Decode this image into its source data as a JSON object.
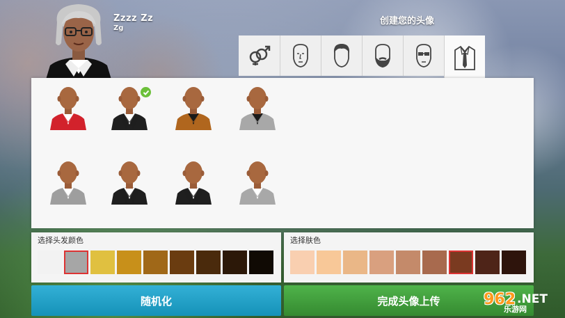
{
  "header": {
    "player_name": "Zzzz  Zz",
    "player_sub": "Zg",
    "title": "创建您的头像"
  },
  "tabs": [
    {
      "name": "gender",
      "icon": "gender-icon",
      "active": false
    },
    {
      "name": "face",
      "icon": "face-icon",
      "active": false
    },
    {
      "name": "hair",
      "icon": "hair-icon",
      "active": false
    },
    {
      "name": "beard",
      "icon": "beard-icon",
      "active": false
    },
    {
      "name": "glasses",
      "icon": "glasses-icon",
      "active": false
    },
    {
      "name": "outfit",
      "icon": "shirt-tie-icon",
      "active": true
    }
  ],
  "outfits": [
    {
      "jacket": "#d2222c",
      "shirt": "#ffffff",
      "selected": false
    },
    {
      "jacket": "#1f1f1f",
      "shirt": "#ffffff",
      "selected": true
    },
    {
      "jacket": "#b0661e",
      "shirt": "#1a1a1a",
      "selected": false
    },
    {
      "jacket": "#a8a8a8",
      "shirt": "#1a1a1a",
      "selected": false
    },
    {
      "jacket": "#9e9e9e",
      "shirt": "#ffffff",
      "selected": false
    },
    {
      "jacket": "#1f1f1f",
      "shirt": "#ffffff",
      "selected": false
    },
    {
      "jacket": "#1f1f1f",
      "shirt": "#ffffff",
      "selected": false
    },
    {
      "jacket": "#a8a8a8",
      "shirt": "#ffffff",
      "selected": false
    }
  ],
  "hair_color": {
    "label": "选择头发颜色",
    "swatches": [
      "#f2f2f2",
      "#a6a6a6",
      "#e0c040",
      "#c8901a",
      "#a06818",
      "#6a3c10",
      "#4a2a0c",
      "#2c1808",
      "#100a04"
    ],
    "selected_index": 1
  },
  "skin_color": {
    "label": "选择肤色",
    "swatches": [
      "#f9cfb0",
      "#f8c898",
      "#eab787",
      "#d9a07f",
      "#c48a6a",
      "#a86a4e",
      "#7a3a20",
      "#4e2418",
      "#2e140c"
    ],
    "selected_index": 6
  },
  "buttons": {
    "random": "随机化",
    "finish": "完成头像上传"
  },
  "watermark": {
    "num": "962",
    "net": ".NET",
    "sub": "乐游网"
  }
}
